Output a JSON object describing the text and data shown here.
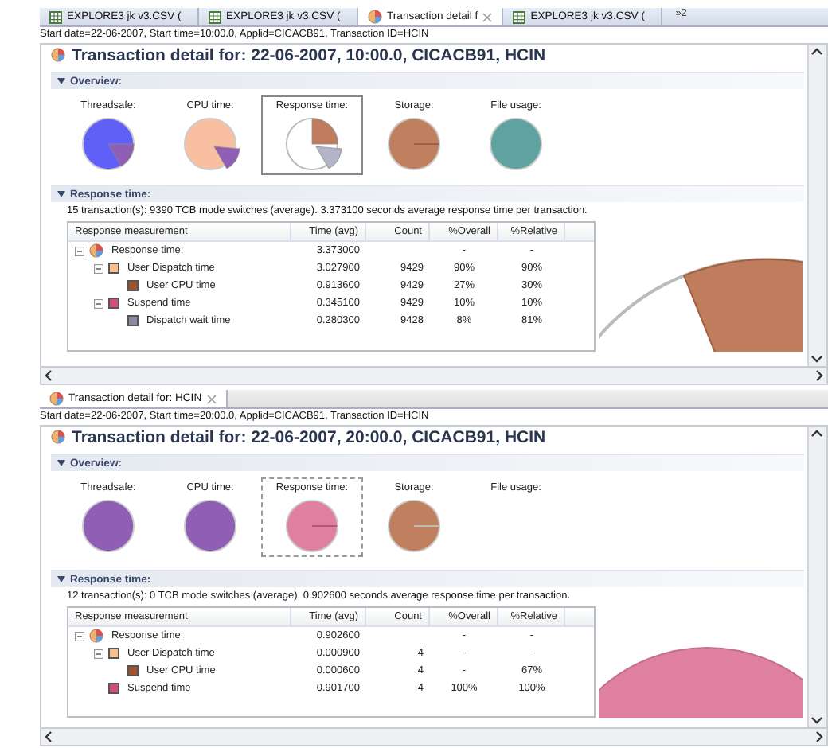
{
  "panes": [
    {
      "active": true,
      "tabs": [
        {
          "label": "EXPLORE3 jk v3.CSV (",
          "kind": "table",
          "selected": false
        },
        {
          "label": "EXPLORE3 jk v3.CSV (",
          "kind": "table",
          "selected": false
        },
        {
          "label": "Transaction detail f",
          "kind": "chart",
          "selected": true
        },
        {
          "label": "EXPLORE3 jk v3.CSV (",
          "kind": "table",
          "selected": false
        }
      ],
      "overflow": "»2",
      "info": "Start date=22-06-2007, Start time=10:00.0, Applid=CICACB91, Transaction ID=HCIN",
      "title": "Transaction detail for: 22-06-2007, 10:00.0, CICACB91, HCIN",
      "overview": {
        "label": "Overview:",
        "charts": [
          {
            "label": "Threadsafe:",
            "selected": false
          },
          {
            "label": "CPU time:",
            "selected": false
          },
          {
            "label": "Response time:",
            "selected": true
          },
          {
            "label": "Storage:",
            "selected": false
          },
          {
            "label": "File usage:",
            "selected": false
          }
        ]
      },
      "response": {
        "label": "Response time:",
        "summary": "15 transaction(s): 9390 TCB mode switches (average). 3.373100 seconds average response time per transaction.",
        "columns": [
          "Response measurement",
          "Time (avg)",
          "Count",
          "%Overall",
          "%Relative"
        ],
        "rows": [
          {
            "label": "Response time:",
            "kind": "pie",
            "time": "3.373000",
            "overall": "-",
            "relative": "-",
            "expanded": true,
            "children": [
              {
                "label": "User Dispatch time",
                "kind": "swatch",
                "color": "#f8c090",
                "time": "3.027900",
                "count": "9429",
                "overall": "90%",
                "relative": "90%",
                "expanded": true,
                "children": [
                  {
                    "label": "User CPU time",
                    "kind": "swatch",
                    "color": "#a0522d",
                    "time": "0.913600",
                    "count": "9429",
                    "overall": "27%",
                    "relative": "30%"
                  }
                ]
              },
              {
                "label": "Suspend time",
                "kind": "swatch",
                "color": "#d05078",
                "time": "0.345100",
                "count": "9429",
                "overall": "10%",
                "relative": "10%",
                "expanded": true,
                "children": [
                  {
                    "label": "Dispatch wait time",
                    "kind": "swatch",
                    "color": "#8a8aa0",
                    "time": "0.280300",
                    "count": "9428",
                    "overall": "8%",
                    "relative": "81%"
                  }
                ]
              }
            ]
          }
        ]
      }
    },
    {
      "active": false,
      "tabs": [
        {
          "label": "Transaction detail for: HCIN",
          "kind": "chart",
          "selected": true
        }
      ],
      "info": "Start date=22-06-2007, Start time=20:00.0, Applid=CICACB91, Transaction ID=HCIN",
      "title": "Transaction detail for: 22-06-2007, 20:00.0, CICACB91, HCIN",
      "overview": {
        "label": "Overview:",
        "charts": [
          {
            "label": "Threadsafe:",
            "selected": false
          },
          {
            "label": "CPU time:",
            "selected": false
          },
          {
            "label": "Response time:",
            "selected": true
          },
          {
            "label": "Storage:",
            "selected": false
          },
          {
            "label": "File usage:",
            "selected": false
          }
        ]
      },
      "response": {
        "label": "Response time:",
        "summary": "12 transaction(s): 0 TCB mode switches (average). 0.902600 seconds average response time per transaction.",
        "columns": [
          "Response measurement",
          "Time (avg)",
          "Count",
          "%Overall",
          "%Relative"
        ],
        "rows": [
          {
            "label": "Response time:",
            "kind": "pie",
            "time": "0.902600",
            "overall": "-",
            "relative": "-",
            "expanded": true,
            "children": [
              {
                "label": "User Dispatch time",
                "kind": "swatch",
                "color": "#f8c090",
                "time": "0.000900",
                "count": "4",
                "overall": "-",
                "relative": "-",
                "expanded": true,
                "children": [
                  {
                    "label": "User CPU time",
                    "kind": "swatch",
                    "color": "#a0522d",
                    "time": "0.000600",
                    "count": "4",
                    "overall": "-",
                    "relative": "67%"
                  }
                ]
              },
              {
                "label": "Suspend time",
                "kind": "swatch",
                "color": "#d05078",
                "time": "0.901700",
                "count": "4",
                "overall": "100%",
                "relative": "100%"
              }
            ]
          }
        ]
      }
    }
  ]
}
